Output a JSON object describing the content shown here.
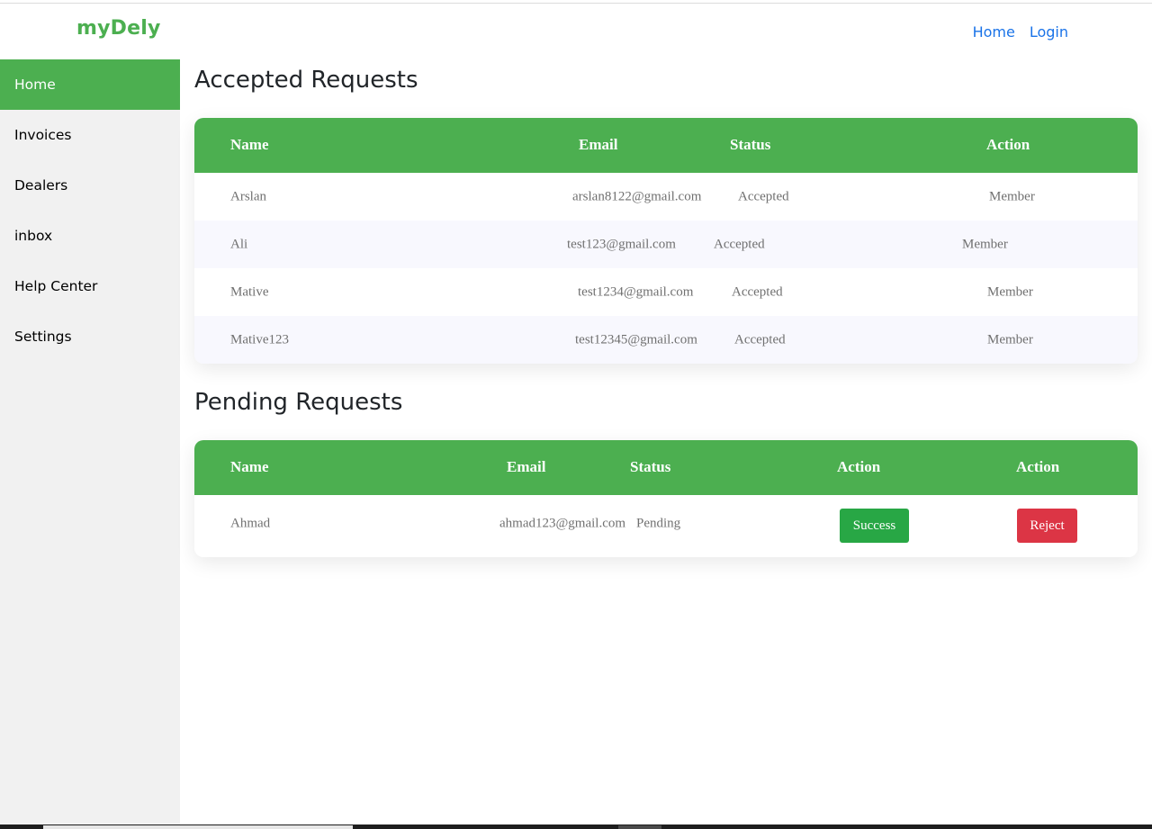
{
  "header": {
    "brand": "myDely",
    "nav": [
      {
        "label": "Home"
      },
      {
        "label": "Login"
      }
    ]
  },
  "sidebar": {
    "items": [
      {
        "label": "Home",
        "active": true
      },
      {
        "label": "Invoices"
      },
      {
        "label": "Dealers"
      },
      {
        "label": "inbox"
      },
      {
        "label": "Help Center"
      },
      {
        "label": "Settings"
      }
    ]
  },
  "accepted": {
    "title": "Accepted Requests",
    "columns": [
      "Name",
      "Email",
      "Status",
      "Action"
    ],
    "rows": [
      {
        "name": "Arslan",
        "email": "arslan8122@gmail.com",
        "status": "Accepted",
        "action": "Member"
      },
      {
        "name": "Ali",
        "email": "test123@gmail.com",
        "status": "Accepted",
        "action": "Member"
      },
      {
        "name": "Mative",
        "email": "test1234@gmail.com",
        "status": "Accepted",
        "action": "Member"
      },
      {
        "name": "Mative123",
        "email": "test12345@gmail.com",
        "status": "Accepted",
        "action": "Member"
      }
    ]
  },
  "pending": {
    "title": "Pending Requests",
    "columns": [
      "Name",
      "Email",
      "Status",
      "Action",
      "Action"
    ],
    "rows": [
      {
        "name": "Ahmad",
        "email": "ahmad123@gmail.com",
        "status": "Pending",
        "success_label": "Success",
        "reject_label": "Reject"
      }
    ]
  },
  "colors": {
    "accent": "#4caf50",
    "link": "#1a73e8",
    "success": "#28a745",
    "danger": "#dc3545"
  }
}
